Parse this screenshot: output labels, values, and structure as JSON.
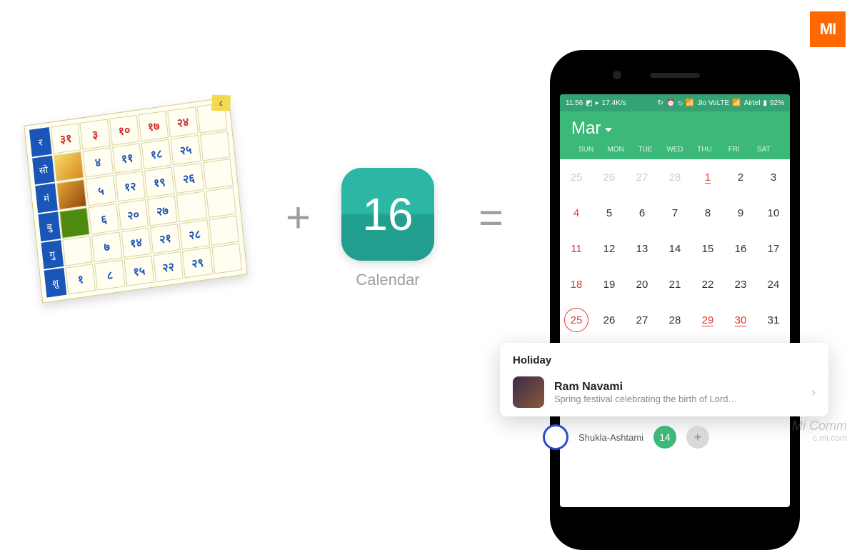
{
  "brand": {
    "logo_text": "MI"
  },
  "symbols": {
    "plus": "+",
    "equal": "="
  },
  "app_icon": {
    "number": "16",
    "label": "Calendar"
  },
  "hindu_calendar": {
    "corner": "८",
    "side_labels": [
      "र",
      "सो",
      "मं",
      "बु",
      "गु",
      "शु"
    ],
    "rows": [
      [
        "३१",
        "३",
        "१०",
        "१७",
        "२४"
      ],
      [
        "img",
        "४",
        "११",
        "१८",
        "२५"
      ],
      [
        "img",
        "५",
        "१२",
        "१९",
        "२६"
      ],
      [
        "green",
        "६",
        "२०",
        "२७",
        ""
      ],
      [
        "",
        "७",
        "१४",
        "२१",
        "२८"
      ],
      [
        "१",
        "८",
        "१५",
        "२२",
        "२९"
      ]
    ]
  },
  "phone": {
    "status": {
      "time": "11:56",
      "speed": "17.4K/s",
      "carrier1": "Jio VoLTE",
      "carrier2": "Airtel",
      "battery": "92%"
    },
    "header": {
      "month": "Mar",
      "dow": [
        "SUN",
        "MON",
        "TUE",
        "WED",
        "THU",
        "FRI",
        "SAT"
      ]
    },
    "weeks": [
      [
        {
          "n": "25",
          "cls": "prev"
        },
        {
          "n": "26",
          "cls": "prev"
        },
        {
          "n": "27",
          "cls": "prev"
        },
        {
          "n": "28",
          "cls": "prev"
        },
        {
          "n": "1",
          "cls": "hol"
        },
        {
          "n": "2",
          "cls": ""
        },
        {
          "n": "3",
          "cls": ""
        }
      ],
      [
        {
          "n": "4",
          "cls": "sun"
        },
        {
          "n": "5"
        },
        {
          "n": "6"
        },
        {
          "n": "7"
        },
        {
          "n": "8"
        },
        {
          "n": "9"
        },
        {
          "n": "10"
        }
      ],
      [
        {
          "n": "11",
          "cls": "sun"
        },
        {
          "n": "12"
        },
        {
          "n": "13"
        },
        {
          "n": "14"
        },
        {
          "n": "15"
        },
        {
          "n": "16"
        },
        {
          "n": "17"
        }
      ],
      [
        {
          "n": "18",
          "cls": "sun"
        },
        {
          "n": "19"
        },
        {
          "n": "20"
        },
        {
          "n": "21"
        },
        {
          "n": "22"
        },
        {
          "n": "23"
        },
        {
          "n": "24"
        }
      ],
      [
        {
          "n": "25",
          "cls": "sun sel"
        },
        {
          "n": "26"
        },
        {
          "n": "27"
        },
        {
          "n": "28"
        },
        {
          "n": "29",
          "cls": "hol"
        },
        {
          "n": "30",
          "cls": "hol"
        },
        {
          "n": "31"
        }
      ]
    ]
  },
  "holiday_card": {
    "heading": "Holiday",
    "title": "Ram Navami",
    "subtitle": "Spring festival celebrating the birth of Lord…"
  },
  "peek": {
    "label": "Shukla-Ashtami",
    "badge": "14"
  },
  "watermark": {
    "line1": "Mi Comm",
    "line2": "c.mi.com"
  }
}
